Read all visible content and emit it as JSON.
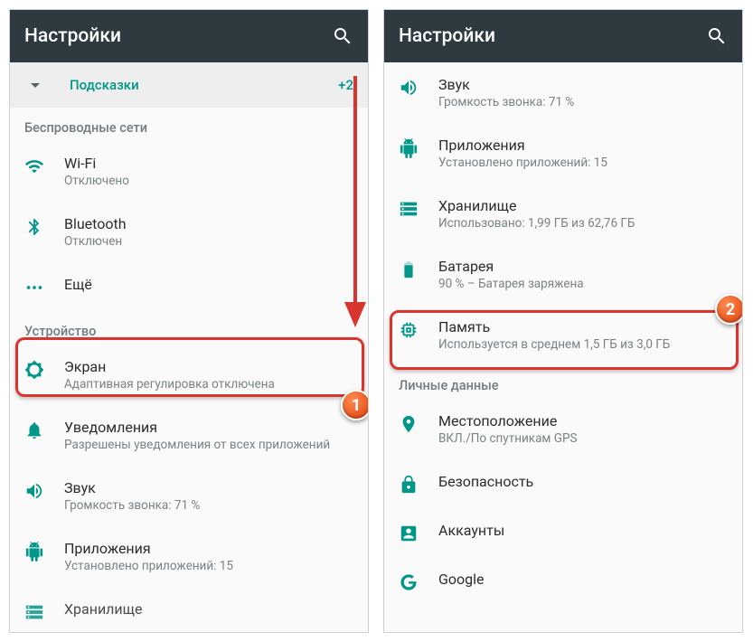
{
  "left": {
    "appbar": {
      "title": "Настройки"
    },
    "hints": {
      "label": "Подсказки",
      "count": "+2"
    },
    "section_wireless": "Беспроводные сети",
    "items_wireless": [
      {
        "icon": "wifi",
        "title": "Wi-Fi",
        "sub": "Отключено"
      },
      {
        "icon": "bluetooth",
        "title": "Bluetooth",
        "sub": "Отключен"
      },
      {
        "icon": "dots",
        "title": "Ещё",
        "sub": ""
      }
    ],
    "section_device": "Устройство",
    "items_device": [
      {
        "icon": "brightness",
        "title": "Экран",
        "sub": "Адаптивная регулировка отключена"
      },
      {
        "icon": "bell",
        "title": "Уведомления",
        "sub": "Разрешены уведомления от всех приложений"
      },
      {
        "icon": "volume",
        "title": "Звук",
        "sub": "Громкость звонка: 71 %"
      },
      {
        "icon": "android",
        "title": "Приложения",
        "sub": "Установлено приложений: 15"
      },
      {
        "icon": "storage",
        "title": "Хранилище",
        "sub": ""
      }
    ]
  },
  "right": {
    "appbar": {
      "title": "Настройки"
    },
    "items_device": [
      {
        "icon": "volume",
        "title": "Звук",
        "sub": "Громкость звонка: 71 %"
      },
      {
        "icon": "android",
        "title": "Приложения",
        "sub": "Установлено приложений: 15"
      },
      {
        "icon": "storage",
        "title": "Хранилище",
        "sub": "Использовано: 1,99 ГБ из 62,76 ГБ"
      },
      {
        "icon": "battery",
        "title": "Батарея",
        "sub": "90 % – Батарея заряжена"
      },
      {
        "icon": "memory",
        "title": "Память",
        "sub": "Используется в среднем 1,5 ГБ из 3,0 ГБ"
      }
    ],
    "section_personal": "Личные данные",
    "items_personal": [
      {
        "icon": "location",
        "title": "Местоположение",
        "sub": "ВКЛ./По спутникам GPS"
      },
      {
        "icon": "lock",
        "title": "Безопасность",
        "sub": ""
      },
      {
        "icon": "account",
        "title": "Аккаунты",
        "sub": ""
      },
      {
        "icon": "google",
        "title": "Google",
        "sub": ""
      }
    ]
  },
  "annotations": {
    "badge1": "1",
    "badge2": "2"
  }
}
